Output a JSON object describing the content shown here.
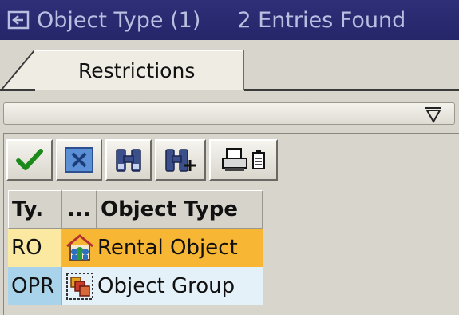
{
  "window": {
    "title": "Object Type (1)",
    "entries": "2 Entries Found"
  },
  "tabs": [
    {
      "label": "Restrictions"
    }
  ],
  "toolbar": {
    "buttons": [
      {
        "name": "confirm",
        "icon": "checkmark-icon"
      },
      {
        "name": "cancel",
        "icon": "close-x-icon"
      },
      {
        "name": "find",
        "icon": "binoculars-icon"
      },
      {
        "name": "find-next",
        "icon": "binoculars-plus-icon"
      },
      {
        "name": "print",
        "icon": "printer-icon"
      }
    ]
  },
  "table": {
    "headers": [
      "Ty.",
      "...",
      "Object Type"
    ],
    "rows": [
      {
        "type": "RO",
        "icon": "rental-object-icon",
        "label": "Rental Object"
      },
      {
        "type": "OPR",
        "icon": "object-group-icon",
        "label": "Object Group"
      }
    ]
  },
  "colors": {
    "title_bar": "#2f2f78",
    "title_text": "#b9bfe0",
    "row1_key": "#fbe9a1",
    "row1_highlight": "#f7b634",
    "row2_key": "#a9d3ea",
    "row2_value": "#e4f1f8"
  }
}
